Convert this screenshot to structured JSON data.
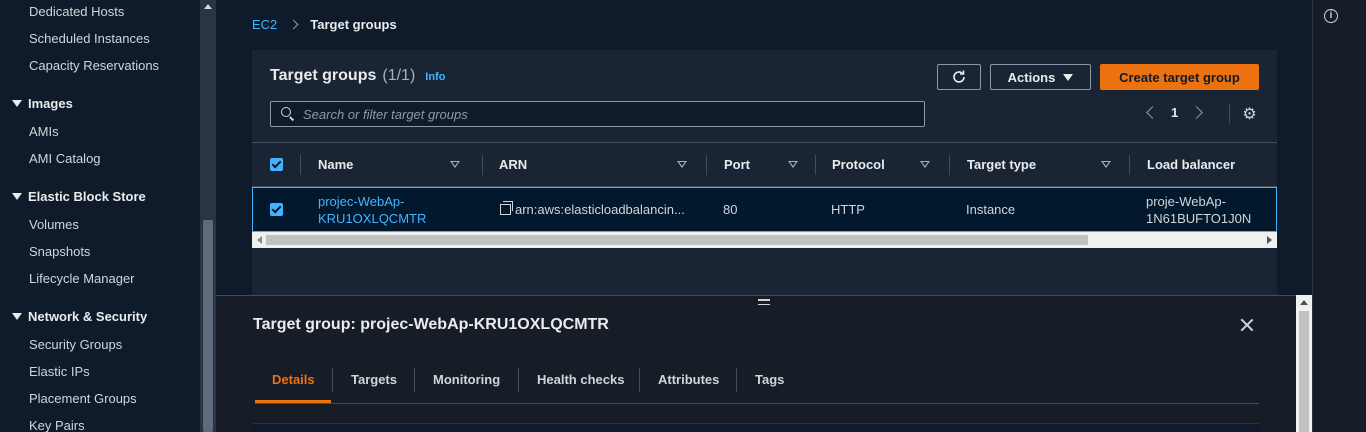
{
  "sidebar": {
    "items_top": [
      "Dedicated Hosts",
      "Scheduled Instances",
      "Capacity Reservations"
    ],
    "images": {
      "title": "Images",
      "items": [
        "AMIs",
        "AMI Catalog"
      ]
    },
    "ebs": {
      "title": "Elastic Block Store",
      "items": [
        "Volumes",
        "Snapshots",
        "Lifecycle Manager"
      ]
    },
    "network": {
      "title": "Network & Security",
      "items": [
        "Security Groups",
        "Elastic IPs",
        "Placement Groups",
        "Key Pairs"
      ]
    }
  },
  "breadcrumb": {
    "root": "EC2",
    "current": "Target groups"
  },
  "panel": {
    "title": "Target groups",
    "count": "(1/1)",
    "info": "Info",
    "actions_label": "Actions",
    "create_label": "Create target group",
    "search_placeholder": "Search or filter target groups",
    "page": "1"
  },
  "table": {
    "columns": [
      "Name",
      "ARN",
      "Port",
      "Protocol",
      "Target type",
      "Load balancer"
    ],
    "rows": [
      {
        "name_line1": "projec-WebAp-",
        "name_line2": "KRU1OXLQCMTR",
        "arn": "arn:aws:elasticloadbalancin...",
        "port": "80",
        "protocol": "HTTP",
        "target_type": "Instance",
        "lb_line1": "proje-WebAp-",
        "lb_line2": "1N61BUFTO1J0N"
      }
    ]
  },
  "detail": {
    "title": "Target group: projec-WebAp-KRU1OXLQCMTR",
    "tabs": [
      "Details",
      "Targets",
      "Monitoring",
      "Health checks",
      "Attributes",
      "Tags"
    ],
    "active_tab": "Details"
  },
  "colors": {
    "accent": "#ec7211",
    "link": "#42b4ff",
    "background": "#0f1b2a",
    "panel": "#192534"
  }
}
